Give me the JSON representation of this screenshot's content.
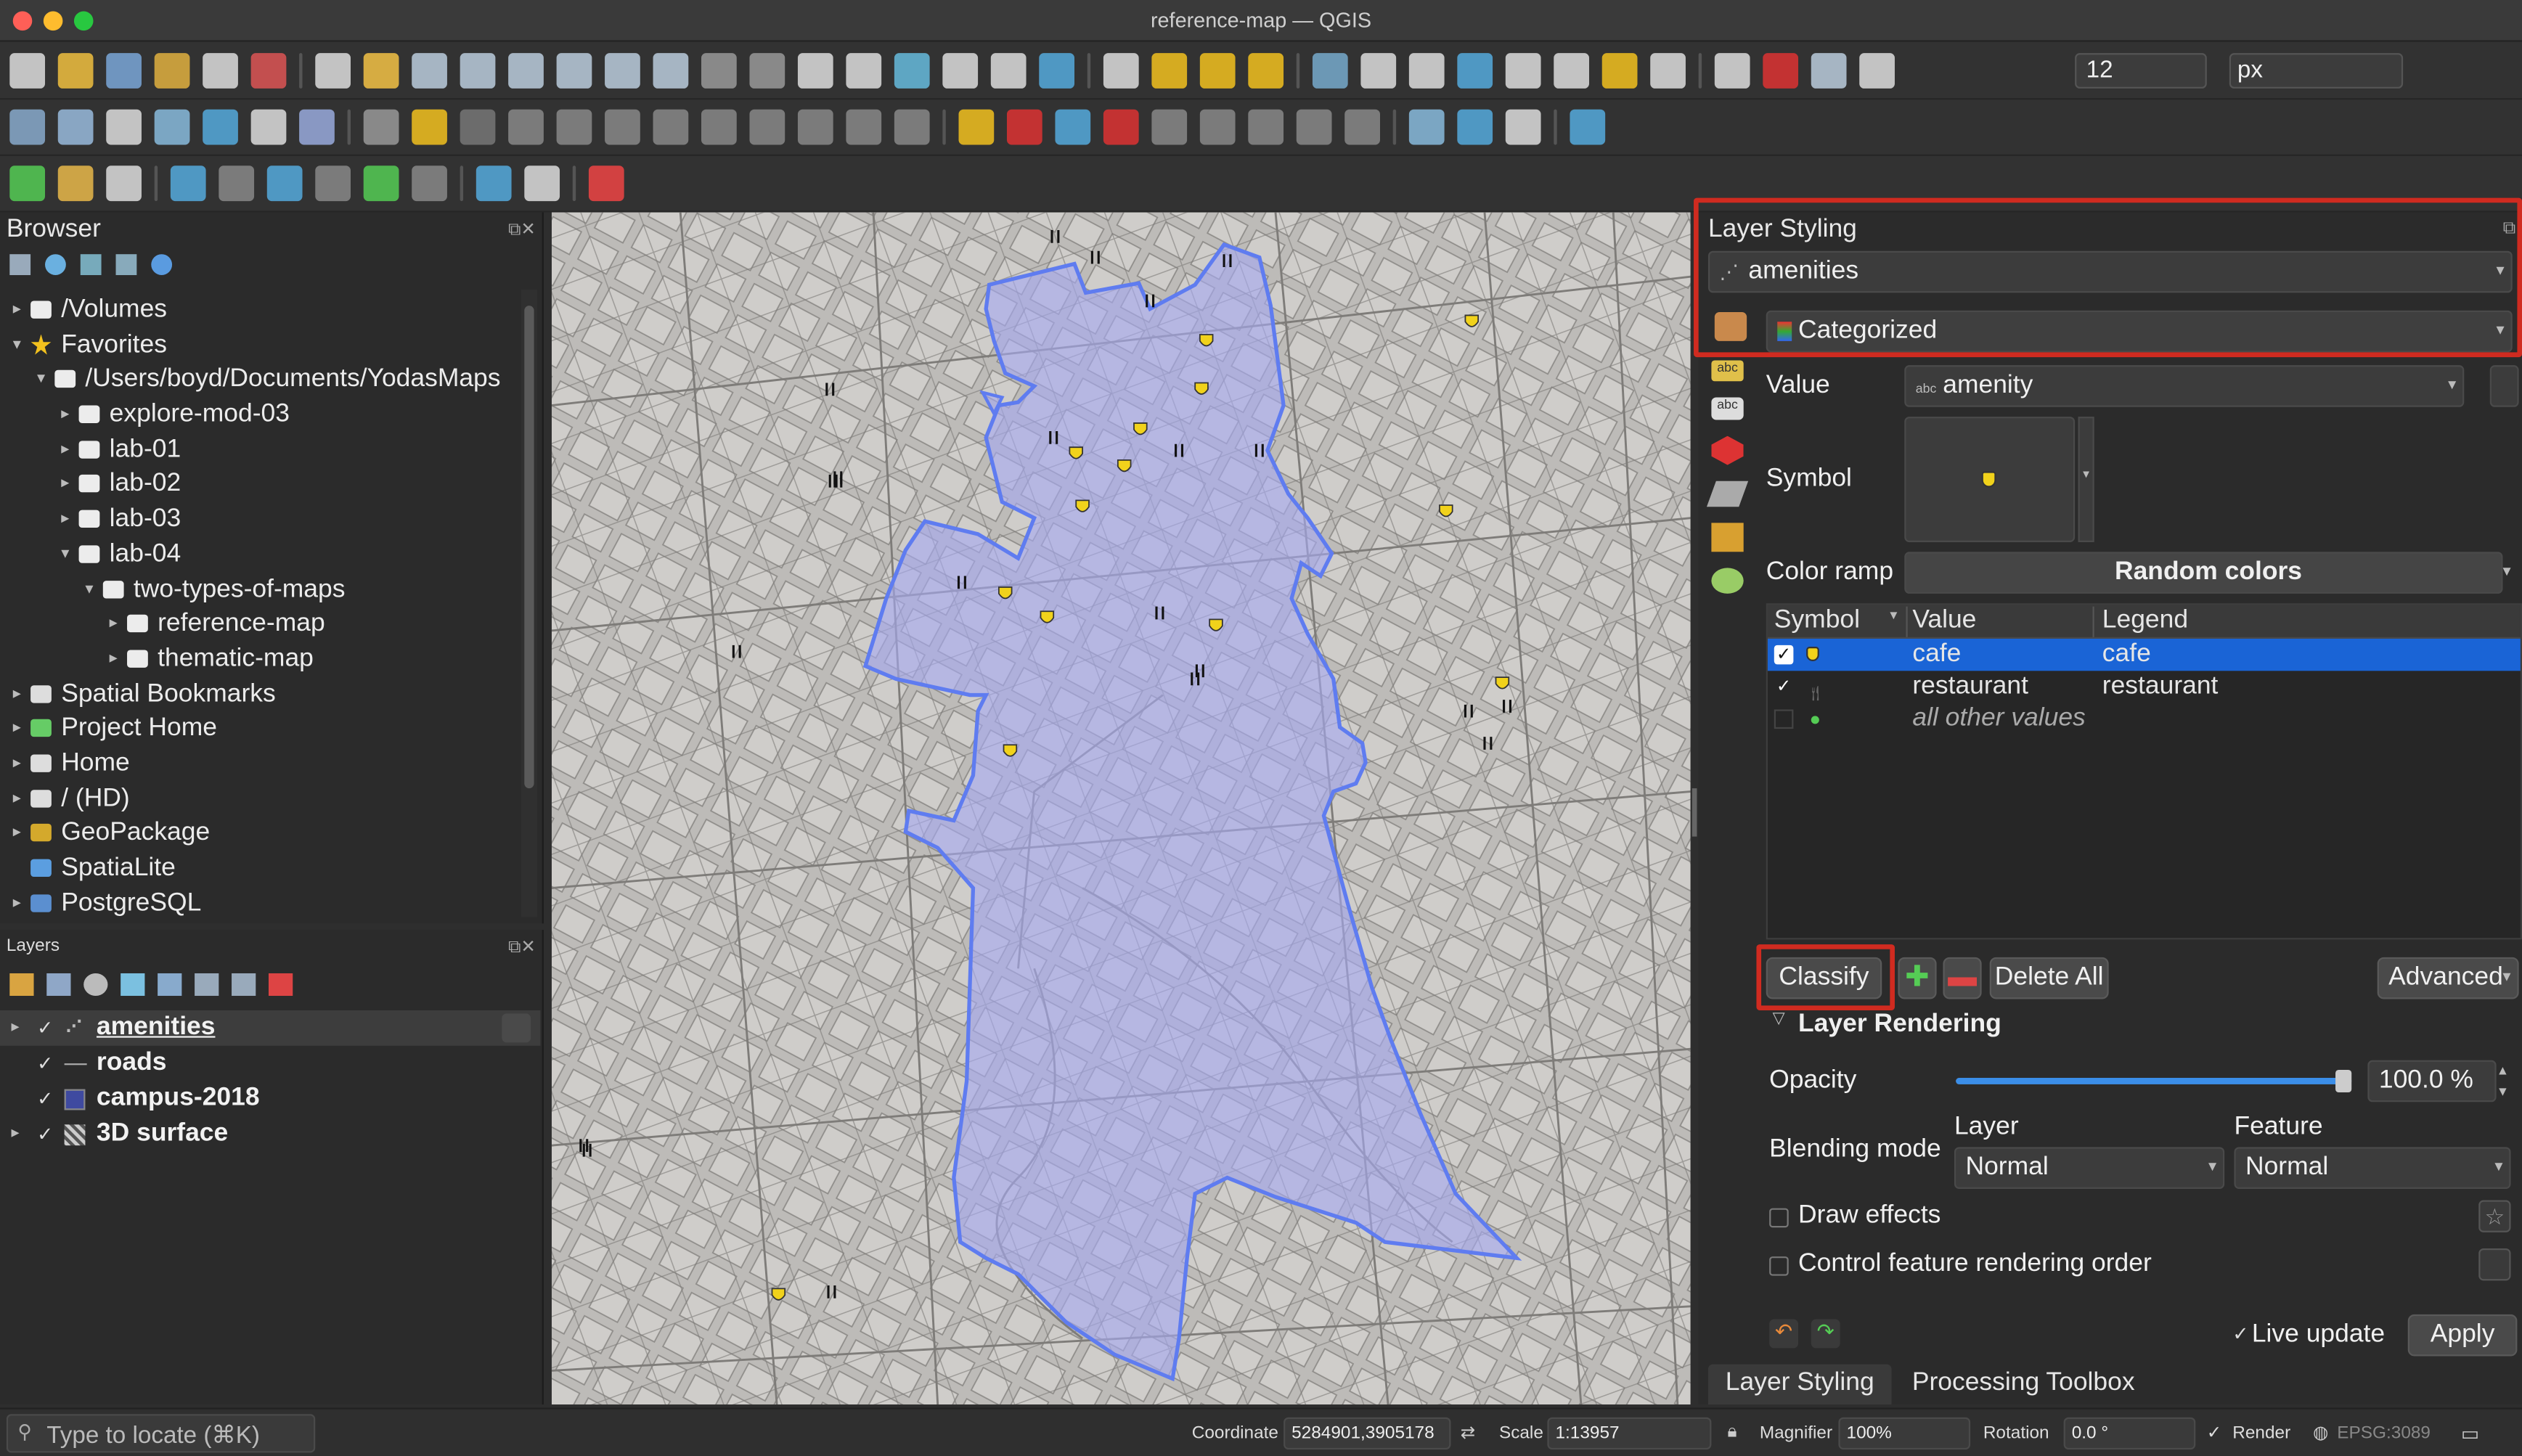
{
  "window": {
    "title": "reference-map — QGIS"
  },
  "toolbar": {
    "scale_value": "12",
    "unit_value": "px"
  },
  "browser": {
    "title": "Browser",
    "items": [
      {
        "label": "/Volumes",
        "icon": "folder-icon"
      },
      {
        "label": "Favorites",
        "icon": "star-icon"
      },
      {
        "label": "/Users/boyd/Documents/YodasMaps",
        "icon": "folder-icon"
      },
      {
        "label": "explore-mod-03",
        "icon": "folder-icon"
      },
      {
        "label": "lab-01",
        "icon": "folder-icon"
      },
      {
        "label": "lab-02",
        "icon": "folder-icon"
      },
      {
        "label": "lab-03",
        "icon": "folder-icon"
      },
      {
        "label": "lab-04",
        "icon": "folder-icon"
      },
      {
        "label": "two-types-of-maps",
        "icon": "folder-icon"
      },
      {
        "label": "reference-map",
        "icon": "folder-icon"
      },
      {
        "label": "thematic-map",
        "icon": "folder-icon"
      },
      {
        "label": "Spatial Bookmarks",
        "icon": "bookmark-icon"
      },
      {
        "label": "Project Home",
        "icon": "project-home-icon"
      },
      {
        "label": "Home",
        "icon": "home-icon"
      },
      {
        "label": "/ (HD)",
        "icon": "drive-icon"
      },
      {
        "label": "GeoPackage",
        "icon": "geopackage-icon"
      },
      {
        "label": "SpatiaLite",
        "icon": "spatialite-icon"
      },
      {
        "label": "PostgreSQL",
        "icon": "postgresql-icon"
      }
    ]
  },
  "layers": {
    "title": "Layers",
    "items": [
      {
        "label": "amenities",
        "checked": true
      },
      {
        "label": "roads",
        "checked": true
      },
      {
        "label": "campus-2018",
        "checked": true
      },
      {
        "label": "3D surface",
        "checked": true
      }
    ]
  },
  "styling": {
    "title": "Layer Styling",
    "layer": "amenities",
    "renderer": "Categorized",
    "value_label": "Value",
    "value": "amenity",
    "symbol_label": "Symbol",
    "color_ramp_label": "Color ramp",
    "color_ramp": "Random colors",
    "table_headers": [
      "Symbol",
      "Value",
      "Legend"
    ],
    "rows": [
      {
        "value": "cafe",
        "legend": "cafe",
        "checked": true,
        "selected": true
      },
      {
        "value": "restaurant",
        "legend": "restaurant",
        "checked": true,
        "selected": false
      },
      {
        "value": "all other values",
        "legend": "",
        "checked": false,
        "selected": false
      }
    ],
    "classify_label": "Classify",
    "delete_all_label": "Delete All",
    "advanced_label": "Advanced",
    "rendering_header": "Layer Rendering",
    "opacity_label": "Opacity",
    "opacity_value": "100.0 %",
    "opacity_fraction": 1.0,
    "blending_label": "Blending mode",
    "blend_layer_label": "Layer",
    "blend_feature_label": "Feature",
    "blend_layer": "Normal",
    "blend_feature": "Normal",
    "draw_effects_label": "Draw effects",
    "control_order_label": "Control feature rendering order",
    "live_update_label": "Live update",
    "apply_label": "Apply",
    "tabs": [
      "Layer Styling",
      "Processing Toolbox"
    ]
  },
  "status": {
    "locate_placeholder": "Type to locate (⌘K)",
    "coordinate_label": "Coordinate",
    "coordinate_value": "5284901,3905178",
    "scale_label": "Scale",
    "scale_value": "1:13957",
    "magnifier_label": "Magnifier",
    "magnifier_value": "100%",
    "rotation_label": "Rotation",
    "rotation_value": "0.0 °",
    "render_label": "Render",
    "crs_label": "EPSG:3089"
  },
  "colors": {
    "highlight": "#d02b20",
    "selection": "#1a64d6",
    "campus_fill": "#a7aaf0",
    "campus_stroke": "#5f7cf0",
    "cafe_marker": "#f1d21b"
  }
}
